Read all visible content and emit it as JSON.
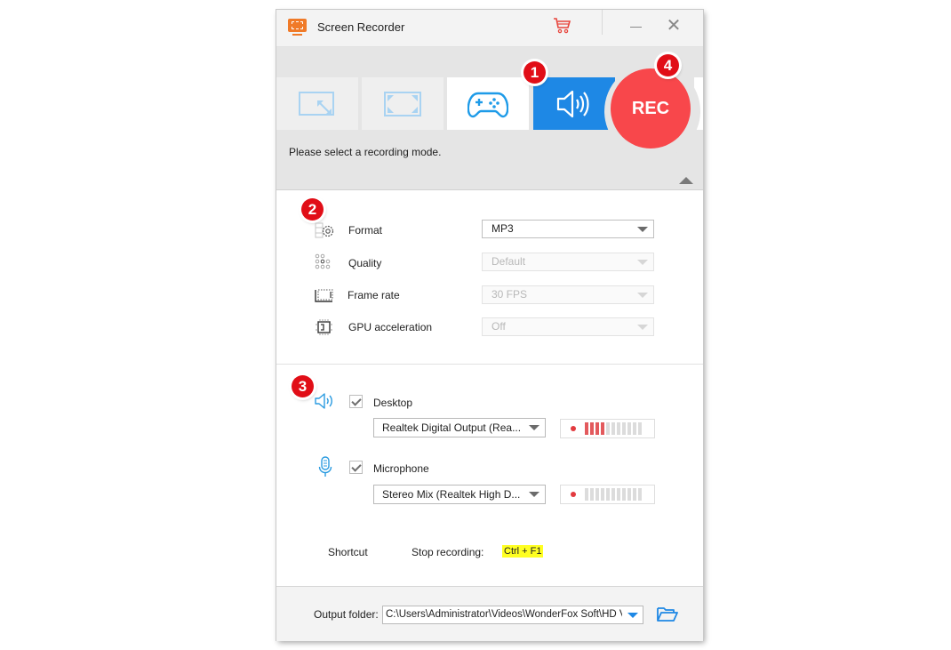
{
  "window": {
    "title": "Screen Recorder",
    "icons": {
      "app": "screen-recorder-icon",
      "cart": "cart-icon",
      "minimize": "minimize-icon",
      "close": "close-icon"
    },
    "close_glyph": "✕"
  },
  "mode_bar": {
    "tabs": [
      {
        "name": "region-mode",
        "icon": "region-resize-icon",
        "selected": false
      },
      {
        "name": "fullscreen-mode",
        "icon": "fullscreen-icon",
        "selected": false
      },
      {
        "name": "game-mode",
        "icon": "gamepad-icon",
        "selected": false
      },
      {
        "name": "audio-only-mode",
        "icon": "speaker-icon",
        "selected": true
      }
    ],
    "rec_label": "REC",
    "hint": "Please select a recording mode.",
    "accent_color": "#1e88e5",
    "rec_color": "#f8474b"
  },
  "badges": [
    "1",
    "2",
    "3",
    "4"
  ],
  "settings": {
    "rows": [
      {
        "label": "Format",
        "icon": "format-gear-icon",
        "value": "MP3",
        "enabled": true
      },
      {
        "label": "Quality",
        "icon": "quality-dots-icon",
        "value": "Default",
        "enabled": false
      },
      {
        "label": "Frame rate",
        "icon": "frame-rate-icon",
        "value": "30 FPS",
        "enabled": false
      },
      {
        "label": "GPU acceleration",
        "icon": "gpu-chip-icon",
        "value": "Off",
        "enabled": false
      }
    ]
  },
  "audio": {
    "desktop": {
      "label": "Desktop",
      "checked": true,
      "device": "Realtek Digital Output (Rea...",
      "level_bars_lit": 4,
      "level_bars_total": 11
    },
    "microphone": {
      "label": "Microphone",
      "checked": true,
      "device": "Stereo Mix (Realtek High D...",
      "level_bars_lit": 0,
      "level_bars_total": 11
    }
  },
  "shortcut": {
    "label": "Shortcut",
    "action": "Stop recording:",
    "keys": "Ctrl + F1"
  },
  "output": {
    "label": "Output folder:",
    "path": "C:\\Users\\Administrator\\Videos\\WonderFox Soft\\HD Vide",
    "browse_icon": "folder-open-icon"
  }
}
